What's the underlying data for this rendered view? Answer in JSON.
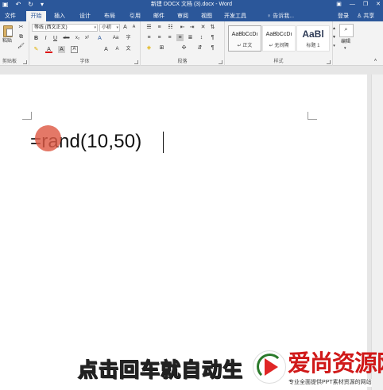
{
  "window": {
    "title": "新建 DOCX 文档 (3).docx - Word",
    "qa_icons": [
      "save-icon",
      "undo-icon",
      "redo-icon",
      "customize-icon"
    ]
  },
  "tabs": [
    {
      "label": "文件",
      "active": false
    },
    {
      "label": "开始",
      "active": true
    },
    {
      "label": "插入",
      "active": false
    },
    {
      "label": "设计",
      "active": false
    },
    {
      "label": "布局",
      "active": false
    },
    {
      "label": "引用",
      "active": false
    },
    {
      "label": "邮件",
      "active": false
    },
    {
      "label": "审阅",
      "active": false
    },
    {
      "label": "视图",
      "active": false
    },
    {
      "label": "开发工具",
      "active": false
    }
  ],
  "tell_me": "♀ 告诉我...",
  "login": "登录",
  "share": "共享",
  "ribbon": {
    "clipboard": {
      "paste": "粘贴",
      "label": "剪贴板"
    },
    "font": {
      "name": "等线 (西文正文)",
      "size": "小初",
      "label": "字体",
      "bold": "B",
      "italic": "I",
      "underline": "U",
      "strike": "abc",
      "sub": "x₂",
      "sup": "x²",
      "grow": "A",
      "shrink": "A",
      "aa": "Aa",
      "clear": "A",
      "highlight": "A",
      "color": "A",
      "shade": "A",
      "enclose": "字"
    },
    "paragraph": {
      "label": "段落"
    },
    "styles": {
      "label": "样式",
      "items": [
        {
          "sample": "AaBbCcDı",
          "name": "↵ 正文"
        },
        {
          "sample": "AaBbCcDı",
          "name": "↵ 无间隔"
        },
        {
          "sample": "AaBl",
          "name": "标题 1"
        }
      ]
    },
    "editing": {
      "label": "编辑"
    }
  },
  "document": {
    "formula": "=rand(10,50)"
  },
  "overlay": {
    "subtitle": "点击回车就自动生",
    "watermark_name": "爱尚资源网",
    "watermark_tag": "专业全面提供PPT素材资源的网站"
  },
  "colors": {
    "accent": "#2b579a",
    "click_marker": "#de5a46",
    "watermark": "#d01919"
  }
}
